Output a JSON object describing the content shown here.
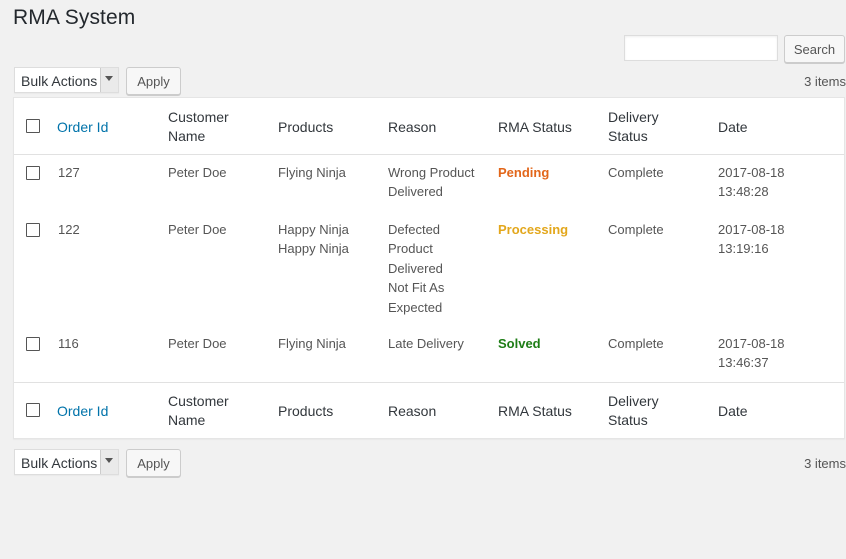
{
  "page": {
    "title": "RMA System"
  },
  "search": {
    "placeholder": "",
    "button": "Search"
  },
  "tablenav_top": {
    "bulk_label": "Bulk Actions",
    "apply": "Apply",
    "count": "3 items"
  },
  "tablenav_bottom": {
    "bulk_label": "Bulk Actions",
    "apply": "Apply",
    "count": "3 items"
  },
  "columns": {
    "order_id": "Order Id",
    "customer_l1": "Customer",
    "customer_l2": "Name",
    "products": "Products",
    "reason": "Reason",
    "rma_status": "RMA Status",
    "delivery_l1": "Delivery",
    "delivery_l2": "Status",
    "date": "Date"
  },
  "rows": [
    {
      "order_id": "127",
      "customer": "Peter Doe",
      "products": [
        "Flying Ninja"
      ],
      "reason": [
        "Wrong Product",
        "Delivered"
      ],
      "status": "Pending",
      "delivery": "Complete",
      "date": [
        "2017-08-18",
        "13:48:28"
      ]
    },
    {
      "order_id": "122",
      "customer": "Peter Doe",
      "products": [
        "Happy Ninja",
        "Happy Ninja"
      ],
      "reason": [
        "Defected",
        "Product",
        "Delivered",
        "Not Fit As",
        "Expected"
      ],
      "status": "Processing",
      "delivery": "Complete",
      "date": [
        "2017-08-18",
        "13:19:16"
      ]
    },
    {
      "order_id": "116",
      "customer": "Peter Doe",
      "products": [
        "Flying Ninja"
      ],
      "reason": [
        "Late Delivery"
      ],
      "status": "Solved",
      "delivery": "Complete",
      "date": [
        "2017-08-18",
        "13:46:37"
      ]
    }
  ],
  "colors": {
    "pending": "#e2661a",
    "processing": "#e3a71c",
    "solved": "#1e7d16",
    "link": "#0073aa"
  }
}
